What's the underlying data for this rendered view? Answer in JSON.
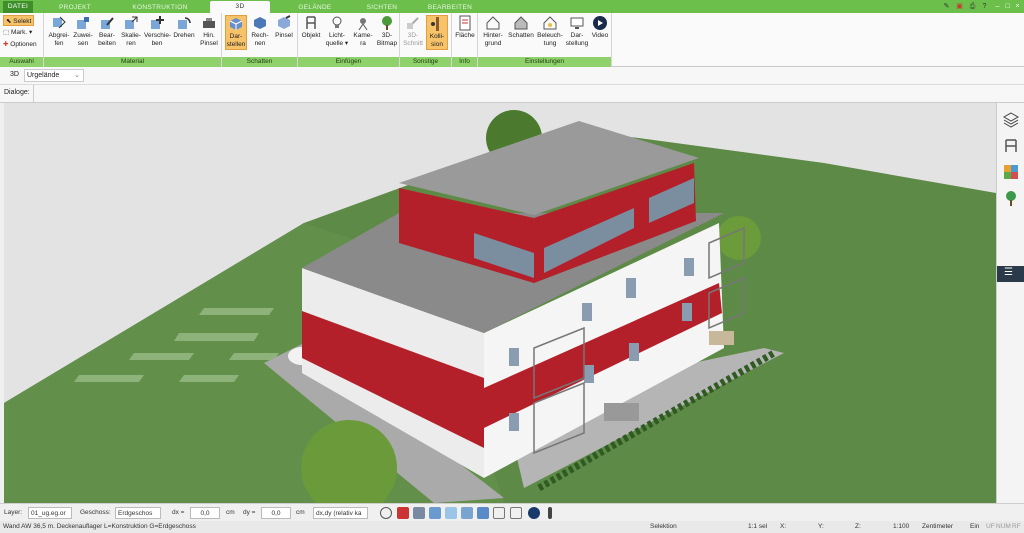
{
  "tabs": [
    "DATEI",
    "PROJEKT",
    "KONSTRUKTION",
    "3D",
    "GELÄNDE",
    "SICHTEN",
    "BEARBEITEN"
  ],
  "active_tab": "3D",
  "selection": {
    "select_label": "Selekt",
    "mark_label": "Mark.",
    "options_label": "Optionen"
  },
  "groups": {
    "auswahl": "Auswahl",
    "material": "Material",
    "schatten": "Schatten",
    "einfuegen": "Einfügen",
    "sonstige": "Sonstige",
    "info": "Info",
    "einstellungen": "Einstellungen"
  },
  "buttons": {
    "abgreifen": [
      "Abgrei-",
      "fen"
    ],
    "zuweisen": [
      "Zuwei-",
      "sen"
    ],
    "bearbeiten": [
      "Bear-",
      "beiten"
    ],
    "skalieren": [
      "Skalie-",
      "ren"
    ],
    "verschieben": [
      "Verschie-",
      "ben"
    ],
    "drehen": [
      "Drehen",
      ""
    ],
    "hin_pinsel": [
      "Hin.",
      "Pinsel"
    ],
    "darstellen": [
      "Dar-",
      "stellen"
    ],
    "rechnen": [
      "Rech-",
      "nen"
    ],
    "pinsel": [
      "Pinsel",
      ""
    ],
    "objekt": [
      "Objekt",
      ""
    ],
    "lichtquelle": [
      "Licht-",
      "quelle ▾"
    ],
    "kamera": [
      "Kame-",
      "ra"
    ],
    "bitmap3d": [
      "3D-",
      "Bitmap"
    ],
    "schnitt3d": [
      "3D-",
      "Schnitt"
    ],
    "kollision": [
      "Kolli-",
      "sion"
    ],
    "flaeche": [
      "Fläche",
      ""
    ],
    "hintergrund": [
      "Hinter-",
      "grund"
    ],
    "schatten_e": [
      "Schatten",
      ""
    ],
    "beleuchtung": [
      "Beleuch-",
      "tung"
    ],
    "darstellung": [
      "Dar-",
      "stellung"
    ],
    "video": [
      "Video",
      ""
    ]
  },
  "subbar": {
    "mode": "3D",
    "dropdown_value": "Urgelände"
  },
  "dialog_label": "Dialoge:",
  "status": {
    "layer_label": "Layer:",
    "layer_value": "01_ug.eg.or",
    "geschoss_label": "Geschoss:",
    "geschoss_value": "Erdgeschos",
    "dx_label": "dx =",
    "dx_value": "0,0",
    "dx_unit": "cm",
    "dy_label": "dy =",
    "dy_value": "0,0",
    "dy_unit": "cm",
    "coord_mode": "dx,dy (relativ ka"
  },
  "info": {
    "element": "Wand AW 36,5 m. Deckenauflager L=Konstruktion G=Erdgeschoss",
    "mode": "Selektion",
    "sel": "1:1 sel",
    "x": "X:",
    "y": "Y:",
    "z": "Z:",
    "scale": "1:100",
    "unit": "Zentimeter",
    "ein": "Ein",
    "uf": "UF",
    "num": "NUM",
    "rf": "RF"
  },
  "colors": {
    "ribbon_green": "#6cbf4a",
    "label_green": "#8fd16a",
    "active_orange": "#f6c36b",
    "wall_red": "#b3202a"
  }
}
